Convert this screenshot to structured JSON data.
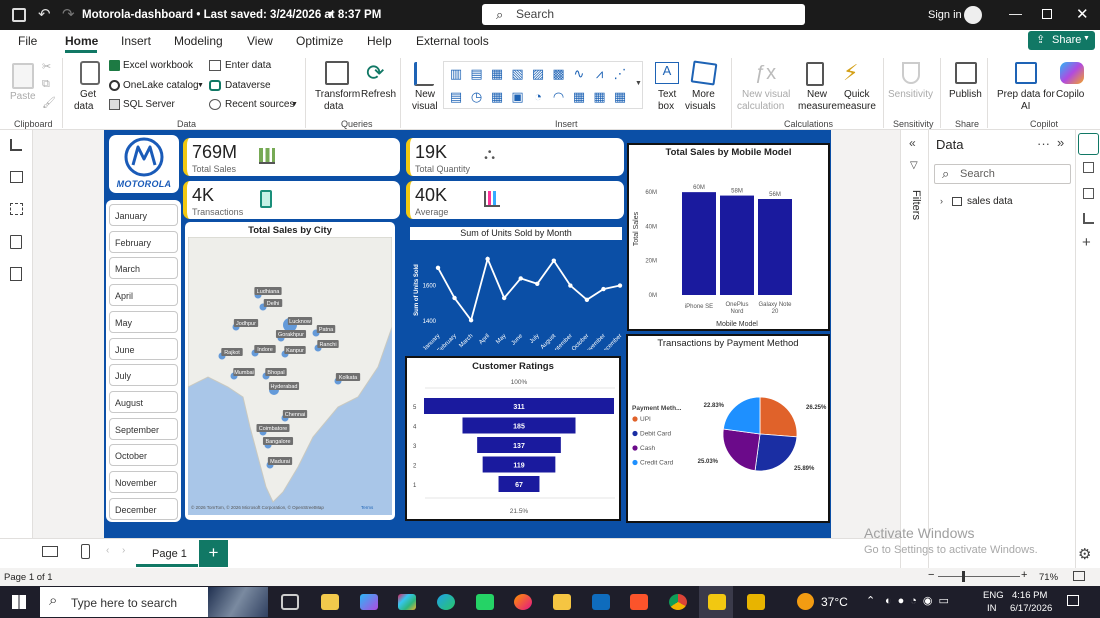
{
  "window": {
    "title": "Motorola-dashboard • Last saved: 3/24/2026 at 8:37 PM",
    "search_placeholder": "Search",
    "signin": "Sign in"
  },
  "menu": [
    "File",
    "Home",
    "Insert",
    "Modeling",
    "View",
    "Optimize",
    "Help",
    "External tools"
  ],
  "share_label": "Share",
  "ribbon": {
    "paste": "Paste",
    "get_data": [
      "Get",
      "data"
    ],
    "excel": "Excel workbook",
    "onelake": "OneLake catalog",
    "sql": "SQL Server",
    "enter_data": "Enter data",
    "dataverse": "Dataverse",
    "recent": "Recent sources",
    "transform": [
      "Transform",
      "data"
    ],
    "refresh": "Refresh",
    "new_visual": [
      "New",
      "visual"
    ],
    "text_box": [
      "Text",
      "box"
    ],
    "more_visuals": [
      "More",
      "visuals"
    ],
    "new_visual_calc": [
      "New visual",
      "calculation"
    ],
    "new_measure": [
      "New",
      "measure"
    ],
    "quick_measure": [
      "Quick",
      "measure"
    ],
    "sensitivity": "Sensitivity",
    "publish": "Publish",
    "prep_data": [
      "Prep data for",
      "AI"
    ],
    "copilot": "Copilo",
    "groups": [
      "Clipboard",
      "Data",
      "Queries",
      "Insert",
      "Calculations",
      "Sensitivity",
      "Share",
      "Copilot"
    ]
  },
  "kpis": [
    {
      "value": "769M",
      "label": "Total Sales"
    },
    {
      "value": "19K",
      "label": "Total Quantity"
    },
    {
      "value": "4K",
      "label": "Transactions"
    },
    {
      "value": "40K",
      "label": "Average"
    }
  ],
  "brand": "MOTOROLA",
  "months": [
    "January",
    "February",
    "March",
    "April",
    "May",
    "June",
    "July",
    "August",
    "September",
    "October",
    "November",
    "December"
  ],
  "map": {
    "title": "Total Sales by City",
    "cities": [
      "Ludhiana",
      "Delhi",
      "Jodhpur",
      "Lucknow",
      "Gorakhpur",
      "Patna",
      "Ranchi",
      "Rajkot",
      "Indore",
      "Kanpur",
      "Mumbai",
      "Bhopal",
      "Kolkata",
      "Hyderabad",
      "Chennai",
      "Coimbatore",
      "Bangalore",
      "Madurai"
    ],
    "copyright": "© 2026 TomTom, © 2026 Microsoft Corporation, © OpenStreetMap",
    "terms": "Terms"
  },
  "line_chart": {
    "title": "Sum of Units Sold by Month",
    "ylabel": "Sum of Units Sold",
    "ticks": [
      "1600",
      "1400"
    ]
  },
  "bar_chart": {
    "title": "Total Sales by Mobile Model",
    "xlabel": "Mobile Model",
    "ylabel": "Total Sales",
    "yticks": [
      "60M",
      "40M",
      "20M",
      "0M"
    ],
    "labels": [
      "60M",
      "58M",
      "56M"
    ],
    "categories_display": [
      "iPhone SE",
      "OnePlus Nord",
      "Galaxy Note 20"
    ]
  },
  "funnel": {
    "title": "Customer Ratings",
    "top_label": "100%",
    "bottom_label": "21.5%"
  },
  "pie": {
    "title": "Transactions by Payment Method",
    "legend_title": "Payment Meth...",
    "labels": [
      "26.25%",
      "25.89%",
      "25.03%",
      "22.83%"
    ]
  },
  "chart_data": [
    {
      "type": "line",
      "title": "Sum of Units Sold by Month",
      "ylabel": "Sum of Units Sold",
      "x": [
        "January",
        "February",
        "March",
        "April",
        "May",
        "June",
        "July",
        "August",
        "September",
        "October",
        "November",
        "December"
      ],
      "values": [
        1700,
        1530,
        1405,
        1750,
        1530,
        1640,
        1610,
        1740,
        1600,
        1520,
        1580,
        1600
      ],
      "ylim": [
        1350,
        1800
      ]
    },
    {
      "type": "bar",
      "title": "Total Sales by Mobile Model",
      "xlabel": "Mobile Model",
      "ylabel": "Total Sales",
      "categories": [
        "iPhone SE",
        "OnePlus Nord",
        "Galaxy Note 20"
      ],
      "values": [
        60,
        58,
        56
      ],
      "ylim": [
        0,
        70
      ]
    },
    {
      "type": "bar",
      "title": "Customer Ratings",
      "categories": [
        "5",
        "4",
        "3",
        "2",
        "1"
      ],
      "values": [
        311,
        185,
        137,
        119,
        67
      ]
    },
    {
      "type": "pie",
      "title": "Transactions by Payment Method",
      "categories": [
        "UPI",
        "Debit Card",
        "Cash",
        "Credit Card"
      ],
      "values": [
        26.25,
        25.89,
        25.03,
        22.83
      ],
      "colors": [
        "#e0622a",
        "#1a2ea3",
        "#6b0a8a",
        "#1e90ff"
      ]
    }
  ],
  "data_pane": {
    "title": "Data",
    "filters": "Filters",
    "search_placeholder": "Search",
    "table": "sales data"
  },
  "page_tab": "Page 1",
  "status": {
    "page": "Page 1 of 1",
    "zoom": "71%"
  },
  "watermark": {
    "line1": "Activate Windows",
    "line2": "Go to Settings to activate Windows."
  },
  "taskbar": {
    "search": "Type here to search",
    "temp": "37°C",
    "lang1": "ENG",
    "lang2": "IN",
    "time": "4:16 PM",
    "date": "6/17/2026"
  },
  "colors": {
    "accent": "#117865",
    "report_bg": "#0b4fa6",
    "bar": "#1a1a9e",
    "kpi_accent": "#f2c811"
  }
}
